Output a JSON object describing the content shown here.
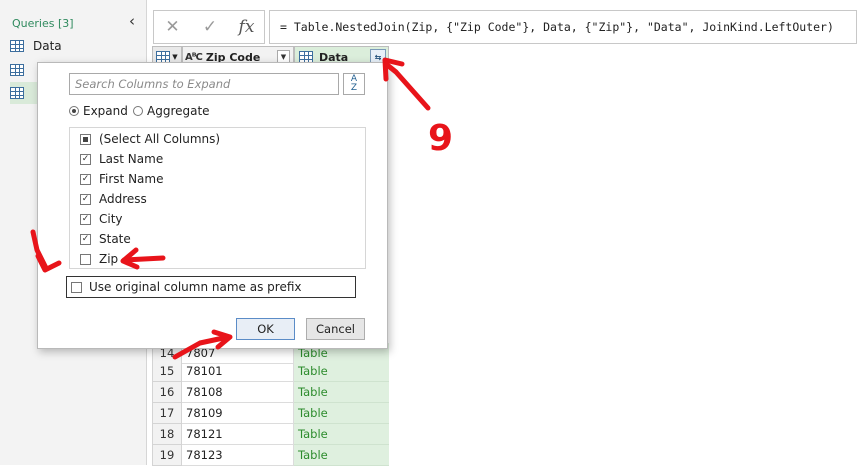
{
  "queries": {
    "header": "Queries [3]",
    "collapse_icon": "‹",
    "items": [
      {
        "label": "Data",
        "icon": "table-icon"
      },
      {
        "label": "",
        "icon": "table-icon"
      },
      {
        "label": "",
        "icon": "table-icon"
      }
    ]
  },
  "formula_bar": {
    "cancel_icon": "✕",
    "commit_icon": "✓",
    "insert_icon": "fx",
    "formula": "= Table.NestedJoin(Zip, {\"Zip Code\"}, Data, {\"Zip\"}, \"Data\", JoinKind.LeftOuter)"
  },
  "grid": {
    "columns": [
      {
        "label": "Zip Code",
        "type_icon": "AᴮC"
      },
      {
        "label": "Data"
      }
    ],
    "rows": [
      {
        "num": "14",
        "zip": "7807",
        "data": "Table"
      },
      {
        "num": "15",
        "zip": "78101",
        "data": "Table"
      },
      {
        "num": "16",
        "zip": "78108",
        "data": "Table"
      },
      {
        "num": "17",
        "zip": "78109",
        "data": "Table"
      },
      {
        "num": "18",
        "zip": "78121",
        "data": "Table"
      },
      {
        "num": "19",
        "zip": "78123",
        "data": "Table"
      }
    ]
  },
  "dialog": {
    "search_placeholder": "Search Columns to Expand",
    "sort_icon": "A Z sort-icon",
    "mode_expand": "Expand",
    "mode_aggregate": "Aggregate",
    "columns": [
      {
        "label": "(Select All Columns)",
        "state": "partial"
      },
      {
        "label": "Last Name",
        "state": "checked"
      },
      {
        "label": "First Name",
        "state": "checked"
      },
      {
        "label": "Address",
        "state": "checked"
      },
      {
        "label": "City",
        "state": "checked"
      },
      {
        "label": "State",
        "state": "checked"
      },
      {
        "label": "Zip",
        "state": "unchecked"
      }
    ],
    "prefix_label": "Use original column name as prefix",
    "prefix_checked": false,
    "ok_label": "OK",
    "cancel_label": "Cancel"
  },
  "annotation_number": "9",
  "colors": {
    "annotation": "#e8141a",
    "accent_green": "#2d8c2d"
  }
}
